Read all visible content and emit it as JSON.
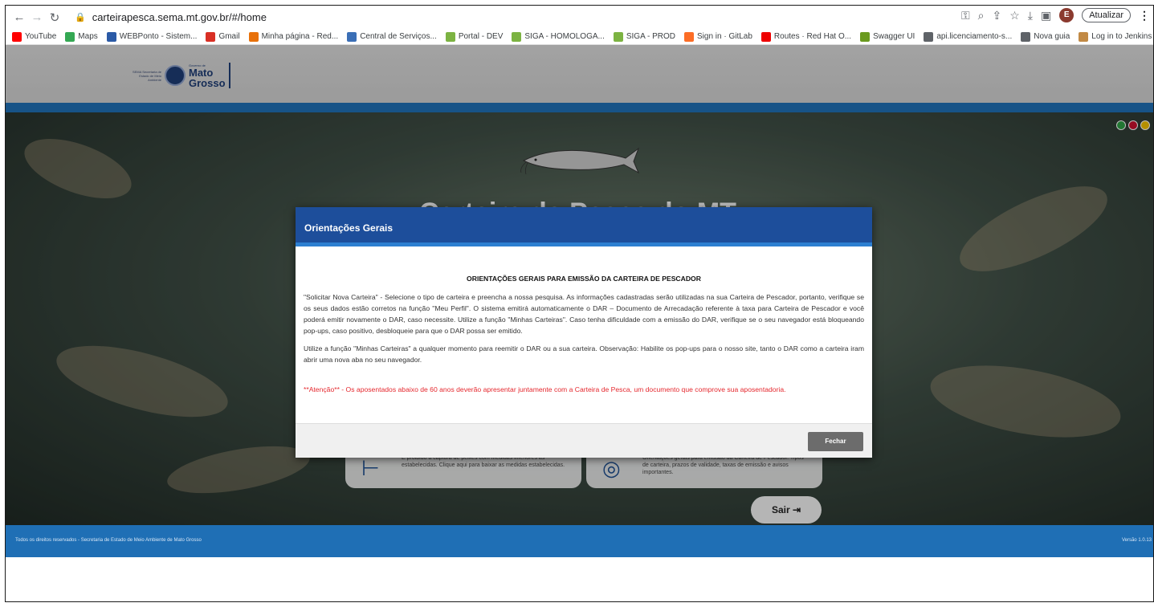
{
  "browser": {
    "url": "carteirapesca.sema.mt.gov.br/#/home",
    "update_label": "Atualizar",
    "profile_letter": "E",
    "bookmarks": [
      {
        "label": "YouTube",
        "color": "#ff0000"
      },
      {
        "label": "Maps",
        "color": "#34a853"
      },
      {
        "label": "WEBPonto - Sistem...",
        "color": "#2b5aa6"
      },
      {
        "label": "Gmail",
        "color": "#d93025"
      },
      {
        "label": "Minha página - Red...",
        "color": "#e8710a"
      },
      {
        "label": "Central de Serviços...",
        "color": "#3b6fb6"
      },
      {
        "label": "Portal - DEV",
        "color": "#7cb342"
      },
      {
        "label": "SIGA - HOMOLOGA...",
        "color": "#7cb342"
      },
      {
        "label": "SIGA - PROD",
        "color": "#7cb342"
      },
      {
        "label": "Sign in · GitLab",
        "color": "#fc6d26"
      },
      {
        "label": "Routes · Red Hat O...",
        "color": "#ee0000"
      },
      {
        "label": "Swagger UI",
        "color": "#6a9a1f"
      },
      {
        "label": "api.licenciamento-s...",
        "color": "#5f6368"
      },
      {
        "label": "Nova guia",
        "color": "#5f6368"
      },
      {
        "label": "Log in to Jenkins us...",
        "color": "#c28a45"
      }
    ]
  },
  "header": {
    "logo_small_text": "SEMA Secretaria de Estado de Meio Ambiente",
    "logo_sub": "Governo de",
    "logo_line1": "Mato",
    "logo_line2": "Grosso"
  },
  "hero": {
    "title": "Carteira de Pesca do MT",
    "card1_text": "É proibido a captura de peixes com medidas inferiores às estabelecidas. Clique aqui para baixar as medidas estabelecidas.",
    "card2_text": "Orientações gerais para emissão da Carteira de Pescador. Tipos de carteira, prazos de validade, taxas de emissão e avisos importantes.",
    "sair_label": "Sair"
  },
  "modal": {
    "header": "Orientações Gerais",
    "title": "ORIENTAÇÕES GERAIS PARA EMISSÃO DA CARTEIRA DE PESCADOR",
    "para1": "\"Solicitar Nova Carteira\" - Selecione o tipo de carteira e preencha a nossa pesquisa. As informações cadastradas serão utilizadas na sua Carteira de Pescador, portanto, verifique se os seus dados estão corretos na função \"Meu Perfil\". O sistema emitirá automaticamente o DAR – Documento de Arrecadação referente à taxa para Carteira de Pescador e você poderá emitir novamente o DAR, caso necessite. Utilize a função \"Minhas Carteiras\". Caso tenha dificuldade com a emissão do DAR, verifique se o seu navegador está bloqueando pop-ups, caso positivo, desbloqueie para que o DAR possa ser emitido.",
    "para2": "Utilize a função \"Minhas Carteiras\" a qualquer momento para reemitir o DAR ou a sua carteira. Observação: Habilite os pop-ups para o nosso site, tanto o DAR como a carteira iram abrir uma nova aba no seu navegador.",
    "attention": "**Atenção** - Os aposentados abaixo de 60 anos deverão apresentar juntamente com a Carteira de Pesca, um documento que comprove sua aposentadoria.",
    "close_label": "Fechar"
  },
  "footer": {
    "rights": "Todos os direitos reservados - Secretaria de Estado de Meio Ambiente de Mato Grosso",
    "version": "Versão 1.0.13"
  },
  "colors": {
    "modal_header": "#1d4e9b",
    "footer_blue": "#1f6fb5",
    "attention_red": "#e5282e"
  }
}
